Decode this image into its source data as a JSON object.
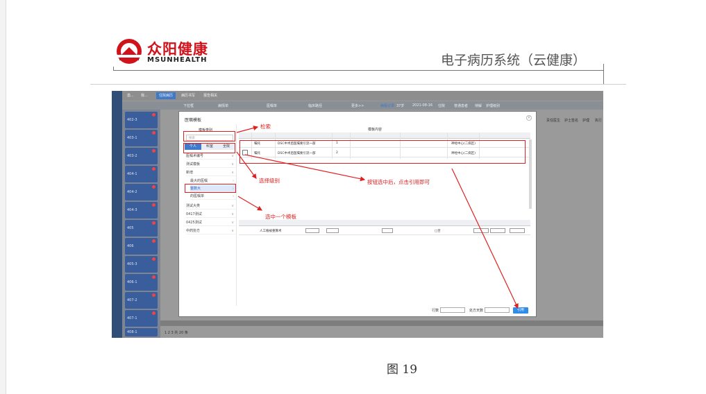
{
  "header": {
    "logo_cn": "众阳健康",
    "logo_en": "MSUNHEALTH",
    "doc_title": "电子病历系统（云健康）"
  },
  "colors": {
    "logo_red": "#d0121b",
    "annotation_red": "#e02020",
    "button_blue": "#2f8ce8"
  },
  "screenshot": {
    "top_tabs": [
      "患...",
      "我...",
      "住院病历",
      "病历书写",
      "报告相关"
    ],
    "subbar_items": [
      "下拉框",
      "病情单",
      "医嘱单",
      "临床路径",
      "更多>>",
      "病程记录",
      "37岁",
      "2021-08-16",
      "住院",
      "普通患者",
      "待解",
      "护理级别"
    ],
    "patients": [
      "402-3",
      "403-1",
      "403-2",
      "404-1",
      "404-2",
      "404-3",
      "405",
      "406",
      "405-3",
      "406-1",
      "407-2",
      "407-1",
      "408-1"
    ],
    "right_cols": [
      "责任医生",
      "护士签名",
      "护理",
      "执行"
    ],
    "footer_pages": "1 2 3 共 20 条"
  },
  "modal": {
    "title": "医嘱模板",
    "left_header": "模板类别",
    "search_placeholder": "搜索",
    "tabs": [
      "个人",
      "科室",
      "全院"
    ],
    "categories": [
      {
        "label": "医嘱术编号",
        "sub": false,
        "selected": false
      },
      {
        "label": "测试模板",
        "sub": false,
        "selected": false
      },
      {
        "label": "新增",
        "sub": false,
        "selected": false
      },
      {
        "label": "最大的医嘱",
        "sub": true,
        "selected": false
      },
      {
        "label": "整数大",
        "sub": true,
        "selected": true
      },
      {
        "label": "的医嘱单",
        "sub": true,
        "selected": false
      },
      {
        "label": "测试大类",
        "sub": false,
        "selected": false
      },
      {
        "label": "0417测试",
        "sub": false,
        "selected": false
      },
      {
        "label": "0425测试",
        "sub": false,
        "selected": false
      },
      {
        "label": "中药协方",
        "sub": false,
        "selected": false
      }
    ],
    "content_label": "模板内容",
    "rows": [
      {
        "type": "嘱托",
        "content": "DSC中术后医嘱要引流一部",
        "num": "1",
        "dept": "神经中心(二病区)"
      },
      {
        "type": "嘱托",
        "content": "DSC中术后医嘱要引流一部",
        "num": "2",
        "dept": "神经中心(二病区)"
      }
    ],
    "bottom_row": {
      "item": "人工植被重算术",
      "flag": "□否"
    },
    "footer": {
      "times_label": "行数",
      "days_label": "处方天数",
      "ref_button": "引用"
    }
  },
  "annotations": {
    "search": "检索",
    "select_level": "选择级别",
    "select_template": "选中一个模板",
    "check_then_ref": "按钮选中后，点击引用即可"
  },
  "caption": "图 19"
}
